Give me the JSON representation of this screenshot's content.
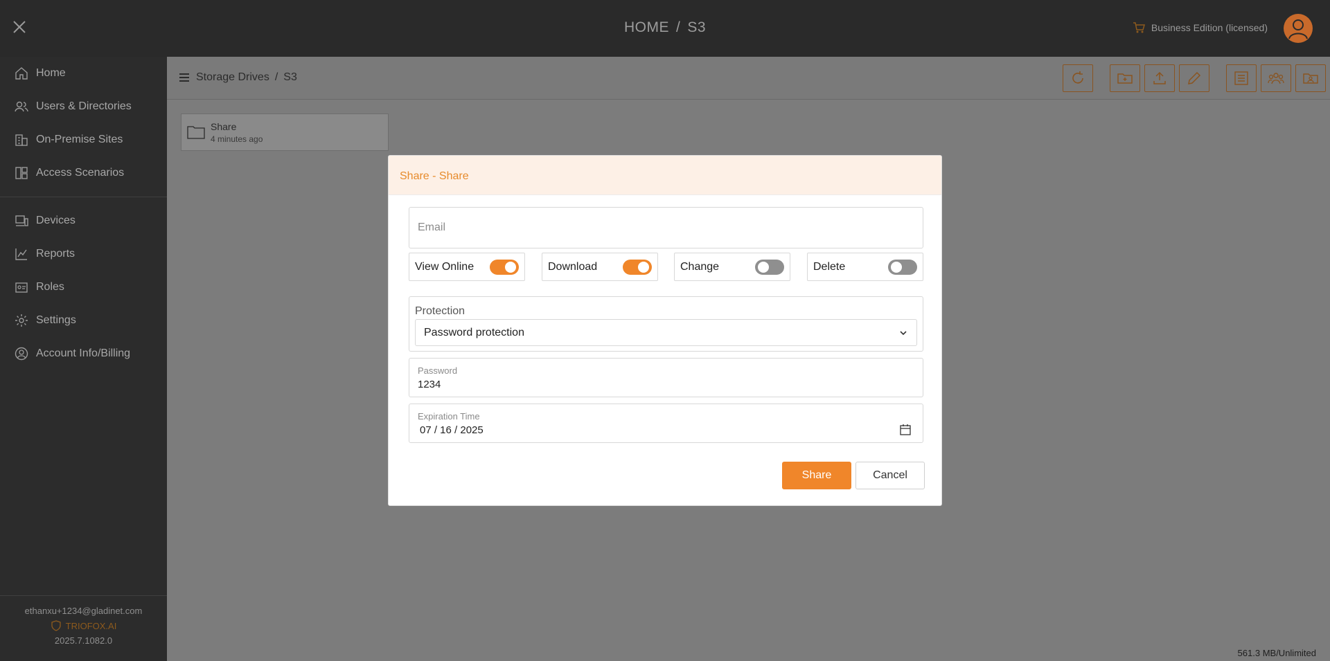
{
  "header": {
    "crumb_home": "HOME",
    "crumb_sep": "/",
    "crumb_current": "S3",
    "edition": "Business Edition (licensed)"
  },
  "sidebar": {
    "group1": [
      {
        "label": "Home",
        "icon": "home-icon"
      },
      {
        "label": "Users & Directories",
        "icon": "users-icon"
      },
      {
        "label": "On-Premise Sites",
        "icon": "building-icon"
      },
      {
        "label": "Access Scenarios",
        "icon": "layout-icon"
      }
    ],
    "group2": [
      {
        "label": "Devices",
        "icon": "devices-icon"
      },
      {
        "label": "Reports",
        "icon": "chart-icon"
      },
      {
        "label": "Roles",
        "icon": "badge-icon"
      },
      {
        "label": "Settings",
        "icon": "gear-icon"
      },
      {
        "label": "Account Info/Billing",
        "icon": "account-icon"
      }
    ],
    "footer": {
      "email": "ethanxu+1234@gladinet.com",
      "brand": "TRIOFOX.AI",
      "version": "2025.7.1082.0"
    }
  },
  "main": {
    "breadcrumb_root": "Storage Drives",
    "breadcrumb_sep": "/",
    "breadcrumb_current": "S3",
    "folder": {
      "name": "Share",
      "time": "4 minutes ago"
    },
    "storage": "561.3 MB/Unlimited"
  },
  "modal": {
    "title": "Share - Share",
    "email_placeholder": "Email",
    "permissions": [
      {
        "label": "View Online",
        "on": true
      },
      {
        "label": "Download",
        "on": true
      },
      {
        "label": "Change",
        "on": false
      },
      {
        "label": "Delete",
        "on": false
      }
    ],
    "protection_label": "Protection",
    "protection_value": "Password protection",
    "password_label": "Password",
    "password_value": "1234",
    "expiration_label": "Expiration Time",
    "expiration_value": "07 / 16 / 2025",
    "share_label": "Share",
    "cancel_label": "Cancel"
  },
  "colors": {
    "accent": "#f0862a",
    "header_bg": "#2a2a2a",
    "sidebar_bg": "#2c2c2c",
    "overlay_bg": "#7c7c7c"
  }
}
